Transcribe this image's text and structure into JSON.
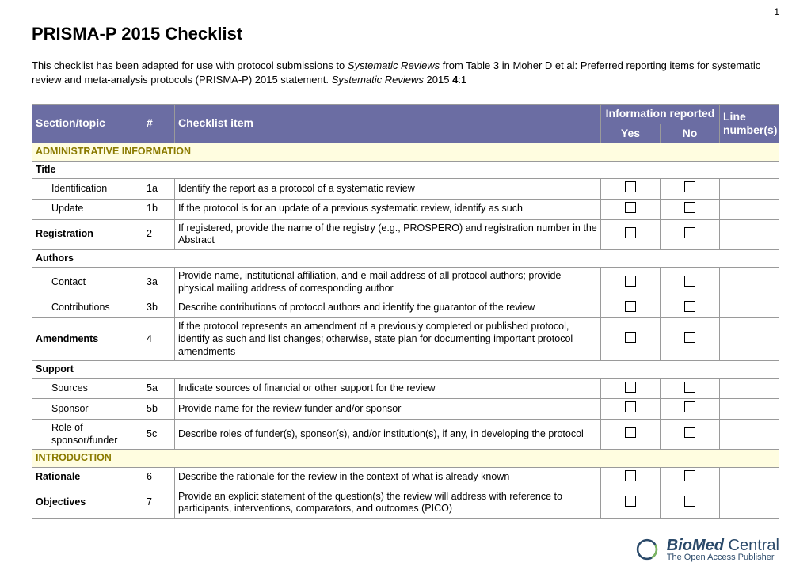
{
  "page_number": "1",
  "title": "PRISMA-P 2015 Checklist",
  "intro_pre": "This checklist has been adapted for use with protocol submissions to ",
  "intro_em1": "Systematic Reviews",
  "intro_mid": " from Table 3 in Moher D et al: Preferred reporting items for systematic review and meta-analysis protocols (PRISMA-P) 2015 statement. ",
  "intro_em2": "Systematic Reviews",
  "intro_post": " 2015 ",
  "intro_vol": "4",
  "intro_issue": ":1",
  "headers": {
    "section": "Section/topic",
    "num": "#",
    "item": "Checklist item",
    "info": "Information reported",
    "yes": "Yes",
    "no": "No",
    "line": "Line number(s)"
  },
  "bands": {
    "admin": "ADMINISTRATIVE INFORMATION",
    "intro": "INTRODUCTION"
  },
  "groups": {
    "title": "Title",
    "authors": "Authors",
    "support": "Support"
  },
  "rows": {
    "r1": {
      "topic": "Identification",
      "num": "1a",
      "item": "Identify the report as a protocol of a systematic review"
    },
    "r2": {
      "topic": "Update",
      "num": "1b",
      "item": "If the protocol is for an update of a previous systematic review, identify as such"
    },
    "r3": {
      "topic": "Registration",
      "num": "2",
      "item": "If registered, provide the name of the registry (e.g., PROSPERO) and registration number in the Abstract"
    },
    "r4": {
      "topic": "Contact",
      "num": "3a",
      "item": "Provide name, institutional affiliation, and e-mail address of all protocol authors; provide physical mailing address of corresponding author"
    },
    "r5": {
      "topic": "Contributions",
      "num": "3b",
      "item": "Describe contributions of protocol authors and identify the guarantor of the review"
    },
    "r6": {
      "topic": "Amendments",
      "num": "4",
      "item": "If the protocol represents an amendment of a previously completed or published protocol, identify as such and list changes; otherwise, state plan for documenting important protocol amendments"
    },
    "r7": {
      "topic": "Sources",
      "num": "5a",
      "item": "Indicate sources of financial or other support for the review"
    },
    "r8": {
      "topic": "Sponsor",
      "num": "5b",
      "item": "Provide name for the review funder and/or sponsor"
    },
    "r9": {
      "topic": "Role of sponsor/funder",
      "num": "5c",
      "item": "Describe roles of funder(s), sponsor(s), and/or institution(s), if any, in developing the protocol"
    },
    "r10": {
      "topic": "Rationale",
      "num": "6",
      "item": "Describe the rationale for the review in the context of what is already known"
    },
    "r11": {
      "topic": "Objectives",
      "num": "7",
      "item": "Provide an explicit statement of the question(s) the review will address with reference to participants, interventions, comparators, and outcomes (PICO)"
    }
  },
  "footer": {
    "brand_bold": "BioMed",
    "brand_light": " Central",
    "tagline": "The Open Access Publisher"
  }
}
